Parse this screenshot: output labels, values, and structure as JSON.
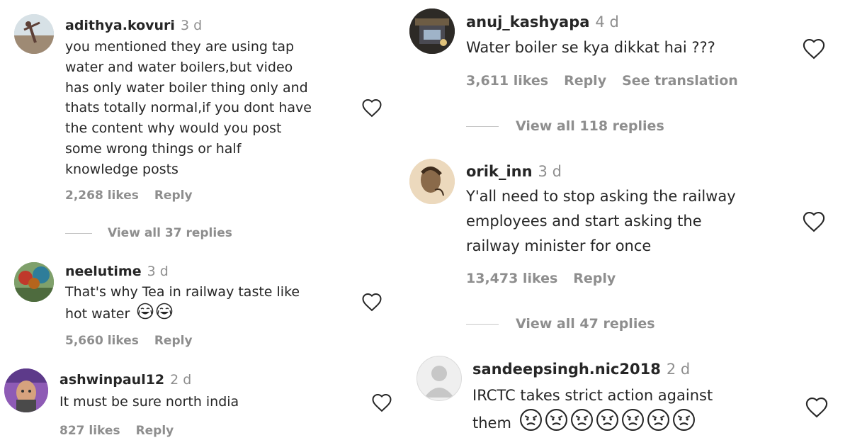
{
  "left": {
    "comments": [
      {
        "username": "adithya.kovuri",
        "time": "3 d",
        "lines": [
          "you mentioned they are using tap",
          "water and water boilers,but video",
          "has only water boiler thing only and",
          "thats totally normal,if you dont have",
          "the content why would you post",
          "some wrong things or half",
          "knowledge posts"
        ],
        "likes": "2,268 likes",
        "reply": "Reply",
        "view_replies": "View all 37 replies"
      },
      {
        "username": "neelutime",
        "time": "3 d",
        "lines": [
          "That's why Tea in railway taste like",
          "hot water"
        ],
        "likes": "5,660 likes",
        "reply": "Reply"
      },
      {
        "username": "ashwinpaul12",
        "time": "2 d",
        "lines": [
          "It must be sure north india"
        ],
        "likes": "827 likes",
        "reply": "Reply"
      }
    ]
  },
  "right": {
    "comments": [
      {
        "username": "anuj_kashyapa",
        "time": "4 d",
        "lines": [
          "Water boiler se kya dikkat hai ???"
        ],
        "likes": "3,611 likes",
        "reply": "Reply",
        "see_translation": "See translation",
        "view_replies": "View all 118 replies"
      },
      {
        "username": "orik_inn",
        "time": "3 d",
        "lines": [
          "Y'all need to stop asking the railway",
          "employees and start asking the",
          "railway minister for once"
        ],
        "likes": "13,473 likes",
        "reply": "Reply",
        "view_replies": "View all 47 replies"
      },
      {
        "username": "sandeepsingh.nic2018",
        "time": "2 d",
        "lines": [
          "IRCTC takes strict action against",
          "them"
        ]
      }
    ]
  },
  "colors": {
    "text": "#262626",
    "muted": "#8e8e8e",
    "divider": "#c7c7c7"
  }
}
